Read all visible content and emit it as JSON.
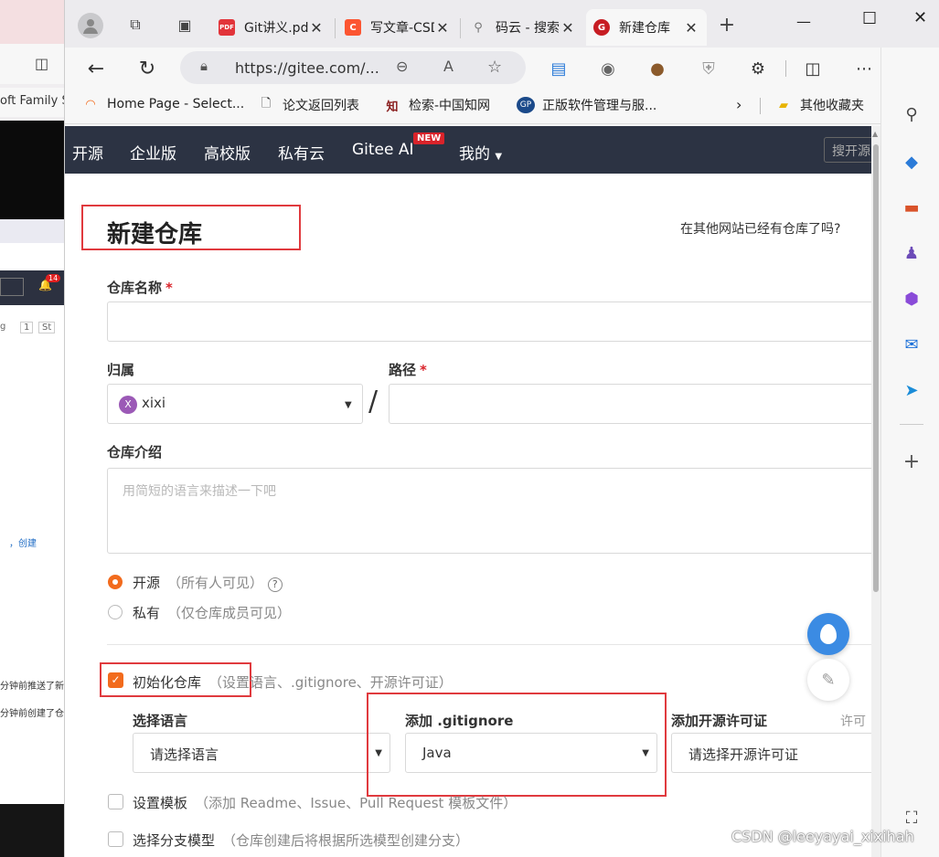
{
  "background_window": {
    "bookmark_fragment": "oft Family S",
    "badge_count": "14",
    "filter_fragment": "g",
    "count_fragment": "1",
    "star_fragment": "St",
    "text_create": "，创建",
    "text_push": "分钟前推送了新",
    "text_created": "分钟前创建了仓"
  },
  "tabs": [
    {
      "title": "Git讲义.pdf",
      "favicon": "pdf-icon",
      "color": "#e2343a",
      "glyph": "PDF"
    },
    {
      "title": "写文章-CSDN",
      "favicon": "csdn-icon",
      "color": "#fc5531",
      "glyph": "C"
    },
    {
      "title": "码云 - 搜索",
      "favicon": "search-icon",
      "color": "#8a8a8a",
      "glyph": "🔍"
    },
    {
      "title": "新建仓库",
      "favicon": "gitee-icon",
      "color": "#c71d23",
      "glyph": "G",
      "active": true
    }
  ],
  "address_bar": {
    "url": "https://gitee.com/..."
  },
  "bookmarks": [
    {
      "label": "Home Page - Select...",
      "icon": "home-page-icon"
    },
    {
      "label": "论文返回列表",
      "icon": "document-icon"
    },
    {
      "label": "检索-中国知网",
      "icon": "cnki-icon"
    },
    {
      "label": "正版软件管理与服...",
      "icon": "software-icon"
    },
    {
      "label": "其他收藏夹",
      "icon": "folder-icon"
    }
  ],
  "gitee_nav": {
    "items": [
      "开源",
      "企业版",
      "高校版",
      "私有云",
      "Gitee AI",
      "我的"
    ],
    "new_badge": "NEW",
    "search_placeholder": "搜开源"
  },
  "form": {
    "title": "新建仓库",
    "import_link": "在其他网站已经有仓库了吗?",
    "name_label": "仓库名称",
    "owner_label": "归属",
    "owner_value": "xixi",
    "owner_avatar": "X",
    "path_label": "路径",
    "path_separator": "/",
    "desc_label": "仓库介绍",
    "desc_placeholder": "用简短的语言来描述一下吧",
    "visibility": {
      "public_label": "开源",
      "public_note": "（所有人可见）",
      "private_label": "私有",
      "private_note": "（仅仓库成员可见）"
    },
    "init": {
      "label": "初始化仓库",
      "note": "（设置语言、.gitignore、开源许可证）",
      "language_label": "选择语言",
      "language_value": "请选择语言",
      "gitignore_label": "添加 .gitignore",
      "gitignore_value": "Java",
      "license_label": "添加开源许可证",
      "license_hint": "许可",
      "license_value": "请选择开源许可证"
    },
    "template": {
      "label": "设置模板",
      "note": "（添加 Readme、Issue、Pull Request 模板文件）"
    },
    "branch": {
      "label": "选择分支模型",
      "note": "（仓库创建后将根据所选模型创建分支）"
    }
  },
  "watermark": "CSDN @leeyayai_xixihah",
  "colors": {
    "accent": "#f26b1d",
    "highlight": "#e03a3e",
    "nav_bg": "#2c3343"
  }
}
